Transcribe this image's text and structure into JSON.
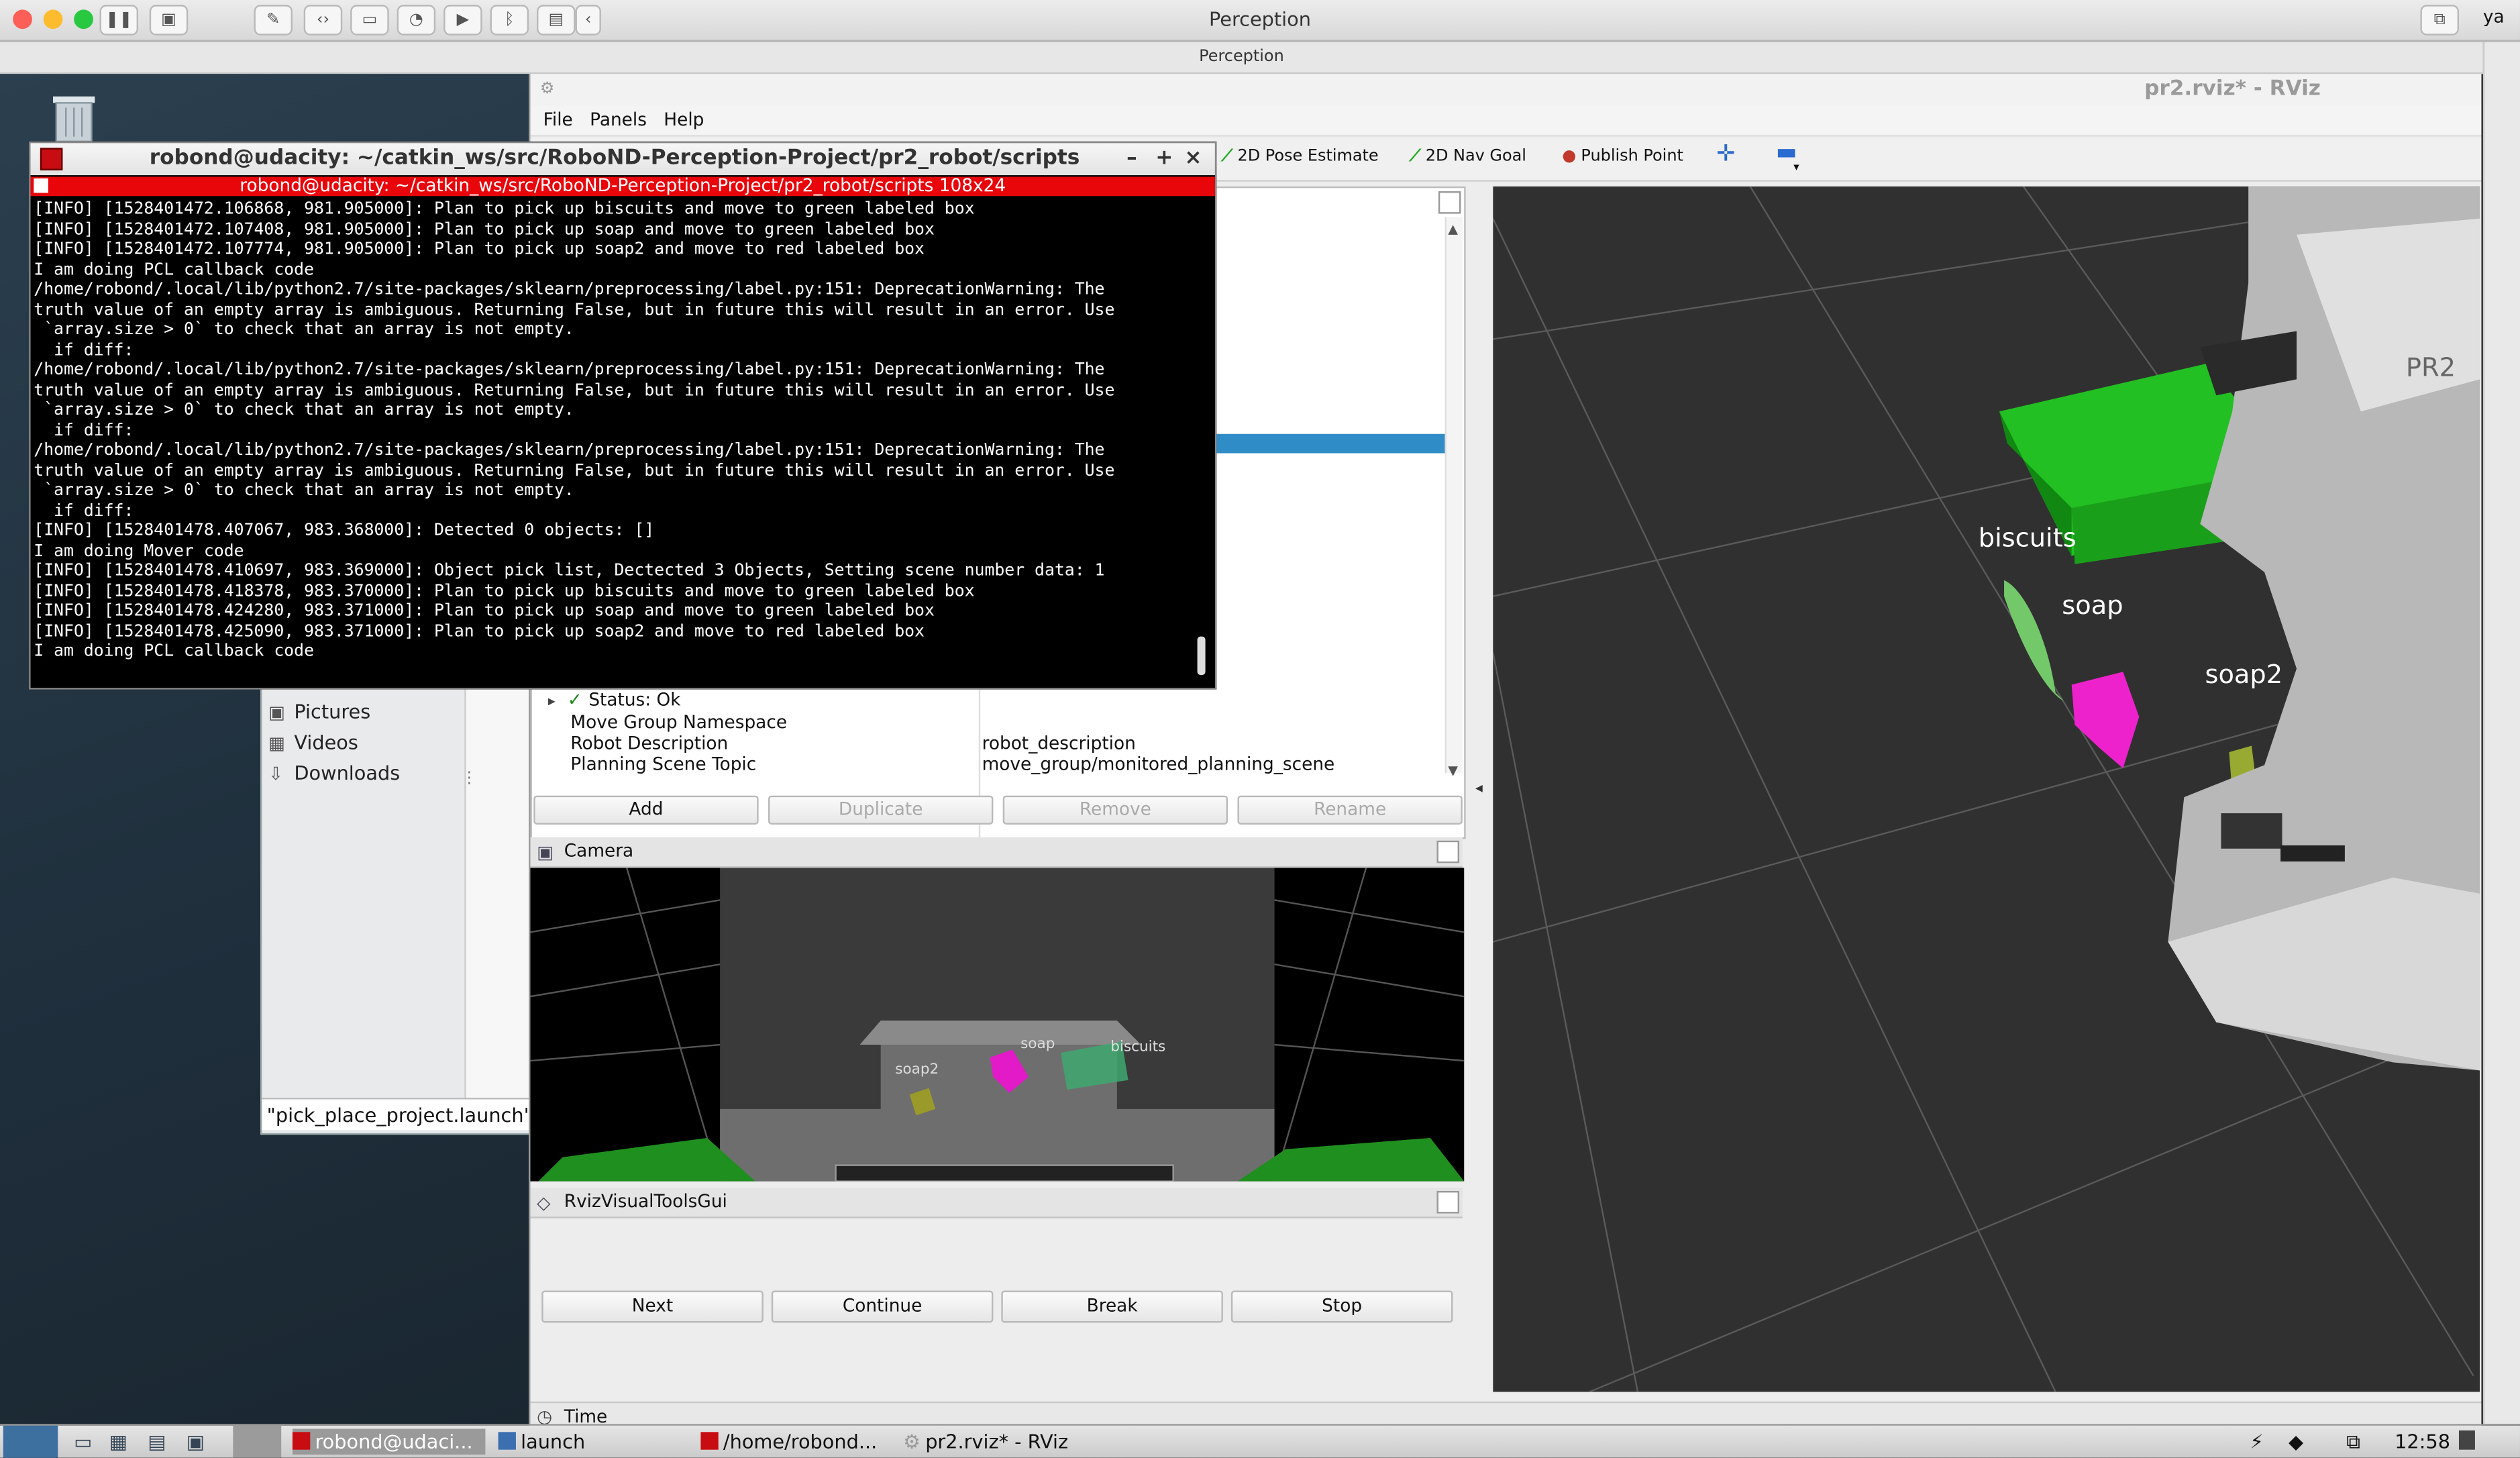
{
  "host": {
    "app_title": "Perception",
    "sub_title": "Perception",
    "user_initials": "ya"
  },
  "rviz": {
    "title": "pr2.rviz* - RViz",
    "menu": [
      "File",
      "Panels",
      "Help"
    ],
    "tools": [
      {
        "label": "2D Pose Estimate",
        "icon": "arrow-green"
      },
      {
        "label": "2D Nav Goal",
        "icon": "arrow-green"
      },
      {
        "label": "Publish Point",
        "icon": "pin-red"
      }
    ],
    "properties": {
      "status": "Status: Ok",
      "rows": [
        {
          "name": "Move Group Namespace",
          "value": ""
        },
        {
          "name": "Robot Description",
          "value": "robot_description"
        },
        {
          "name": "Planning Scene Topic",
          "value": "move_group/monitored_planning_scene"
        }
      ]
    },
    "panel_buttons": {
      "add": "Add",
      "duplicate": "Duplicate",
      "remove": "Remove",
      "rename": "Rename"
    },
    "camera_panel": {
      "title": "Camera",
      "labels": {
        "soap2": "soap2",
        "soap": "soap",
        "biscuits": "biscuits"
      }
    },
    "visual_tools_panel": {
      "title": "RvizVisualToolsGui",
      "buttons": {
        "next": "Next",
        "continue": "Continue",
        "break": "Break",
        "stop": "Stop"
      }
    },
    "time_panel": {
      "title": "Time"
    },
    "viewport_labels": {
      "biscuits": "biscuits",
      "soap": "soap",
      "soap2": "soap2"
    }
  },
  "file_manager": {
    "items": [
      "Pictures",
      "Videos",
      "Downloads"
    ],
    "footer": "\"pick_place_project.launch\" ("
  },
  "terminal": {
    "title": "robond@udacity: ~/catkin_ws/src/RoboND-Perception-Project/pr2_robot/scripts",
    "inner_title": "robond@udacity: ~/catkin_ws/src/RoboND-Perception-Project/pr2_robot/scripts 108x24",
    "lines": [
      "[INFO] [1528401472.106868, 981.905000]: Plan to pick up biscuits and move to green labeled box",
      "[INFO] [1528401472.107408, 981.905000]: Plan to pick up soap and move to green labeled box",
      "[INFO] [1528401472.107774, 981.905000]: Plan to pick up soap2 and move to red labeled box",
      "I am doing PCL callback code",
      "/home/robond/.local/lib/python2.7/site-packages/sklearn/preprocessing/label.py:151: DeprecationWarning: The",
      "truth value of an empty array is ambiguous. Returning False, but in future this will result in an error. Use",
      " `array.size > 0` to check that an array is not empty.",
      "  if diff:",
      "/home/robond/.local/lib/python2.7/site-packages/sklearn/preprocessing/label.py:151: DeprecationWarning: The",
      "truth value of an empty array is ambiguous. Returning False, but in future this will result in an error. Use",
      " `array.size > 0` to check that an array is not empty.",
      "  if diff:",
      "/home/robond/.local/lib/python2.7/site-packages/sklearn/preprocessing/label.py:151: DeprecationWarning: The",
      "truth value of an empty array is ambiguous. Returning False, but in future this will result in an error. Use",
      " `array.size > 0` to check that an array is not empty.",
      "  if diff:",
      "[INFO] [1528401478.407067, 983.368000]: Detected 0 objects: []",
      "I am doing Mover code",
      "[INFO] [1528401478.410697, 983.369000]: Object pick list, Dectected 3 Objects, Setting scene number data: 1",
      "[INFO] [1528401478.418378, 983.370000]: Plan to pick up biscuits and move to green labeled box",
      "[INFO] [1528401478.424280, 983.371000]: Plan to pick up soap and move to green labeled box",
      "[INFO] [1528401478.425090, 983.371000]: Plan to pick up soap2 and move to red labeled box",
      "I am doing PCL callback code"
    ]
  },
  "taskbar": {
    "tasks": [
      "robond@udaci...",
      "launch",
      "/home/robond...",
      "pr2.rviz* - RViz"
    ],
    "clock": "12:58"
  }
}
